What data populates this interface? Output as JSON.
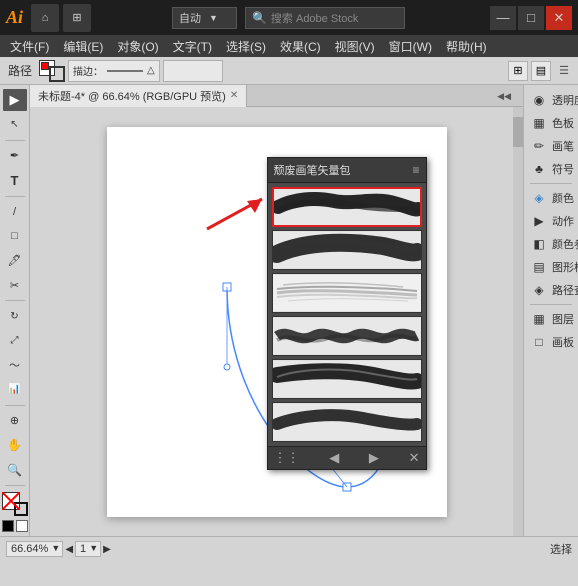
{
  "titlebar": {
    "logo": "Ai",
    "dropdown_label": "自动",
    "search_placeholder": "搜索 Adobe Stock",
    "minimize": "—",
    "maximize": "□",
    "close": "✕"
  },
  "menubar": {
    "items": [
      "文件(F)",
      "编辑(E)",
      "对象(O)",
      "文字(T)",
      "选择(S)",
      "效果(C)",
      "视图(V)",
      "窗口(W)",
      "帮助(H)"
    ]
  },
  "toolbar": {
    "label": "路径",
    "stroke_label": "描边：",
    "stroke_value": "△"
  },
  "tab": {
    "title": "未标题-4* @ 66.64% (RGB/GPU 预览)",
    "close": "✕"
  },
  "brush_panel": {
    "title": "颓废画笔矢量包",
    "menu_icon": "≡",
    "strokes": [
      {
        "id": 1,
        "selected": true
      },
      {
        "id": 2,
        "selected": false
      },
      {
        "id": 3,
        "selected": false
      },
      {
        "id": 4,
        "selected": false
      },
      {
        "id": 5,
        "selected": false
      },
      {
        "id": 6,
        "selected": false
      }
    ],
    "footer_left": "⋮⋮",
    "footer_prev": "◀",
    "footer_next": "▶",
    "footer_close": "✕"
  },
  "right_panel": {
    "items": [
      {
        "icon": "◉",
        "label": "透明度",
        "has_arrow": false
      },
      {
        "icon": "▦",
        "label": "色板",
        "has_arrow": false
      },
      {
        "icon": "✏",
        "label": "画笔",
        "has_arrow": false
      },
      {
        "icon": "♣",
        "label": "符号",
        "has_arrow": false
      },
      {
        "icon": "◈",
        "label": "颜色",
        "has_arrow": false
      },
      {
        "icon": "▶",
        "label": "动作",
        "has_arrow": false
      },
      {
        "icon": "◧",
        "label": "颜色参考",
        "has_arrow": false
      },
      {
        "icon": "▤",
        "label": "图形样式",
        "has_arrow": false
      },
      {
        "icon": "◈",
        "label": "路径查...",
        "has_arrow": false
      },
      {
        "icon": "▦",
        "label": "图层",
        "has_arrow": false
      },
      {
        "icon": "□",
        "label": "画板",
        "has_arrow": false
      }
    ]
  },
  "status": {
    "zoom": "66.64%",
    "page_label": "1",
    "right_label": "选择"
  },
  "tools": {
    "items": [
      "▶",
      "↖",
      "✏",
      "T",
      "/",
      "□",
      "◯",
      "🖊",
      "✂",
      "◈",
      "📐",
      "📊",
      "☁",
      "⊕",
      "✋",
      "🔍"
    ]
  }
}
